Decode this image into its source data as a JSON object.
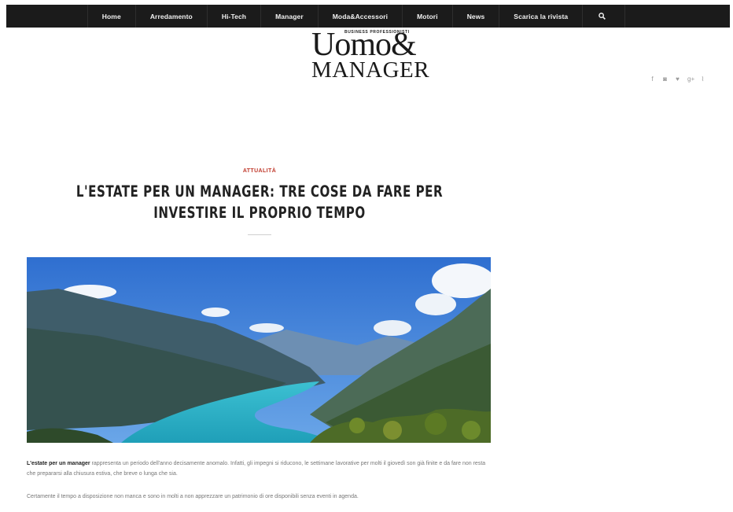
{
  "nav": {
    "items": [
      {
        "label": "Home"
      },
      {
        "label": "Arredamento"
      },
      {
        "label": "Hi-Tech"
      },
      {
        "label": "Manager"
      },
      {
        "label": "Moda&Accessori"
      },
      {
        "label": "Motori"
      },
      {
        "label": "News"
      },
      {
        "label": "Scarica la rivista"
      }
    ],
    "search_icon": "search-icon"
  },
  "logo": {
    "tagline": "BUSINESS PROFESSIONISTI",
    "line1": "Uomo&",
    "line2": "MANAGER"
  },
  "social": [
    {
      "icon": "facebook-icon",
      "glyph": "f"
    },
    {
      "icon": "instagram-icon",
      "glyph": "◙"
    },
    {
      "icon": "twitter-icon",
      "glyph": "♥"
    },
    {
      "icon": "google-plus-icon",
      "glyph": "g+"
    },
    {
      "icon": "rss-icon",
      "glyph": "⌇"
    }
  ],
  "article": {
    "category": "ATTUALITÀ",
    "title": "L'ESTATE PER UN MANAGER: TRE COSE DA FARE PER INVESTIRE IL PROPRIO TEMPO",
    "image_alt": "Lake between mountains",
    "p1_bold": "L'estate per un manager",
    "p1_rest": " rappresenta un periodo dell'anno decisamente anomalo. Infatti, gli impegni si riducono, le settimane lavorative per molti il giovedì son già finite e da fare non resta che prepararsi alla chiusura estiva, che breve o lunga che sia.",
    "p2": "Certamente il tempo a disposizione non manca e sono in molti a non apprezzare un patrimonio di ore disponibili senza eventi in agenda."
  },
  "colors": {
    "nav_bg": "#1b1b1b",
    "category": "#c0392b",
    "lake": "#2fb4c8",
    "sky": "#3a7fd6"
  }
}
